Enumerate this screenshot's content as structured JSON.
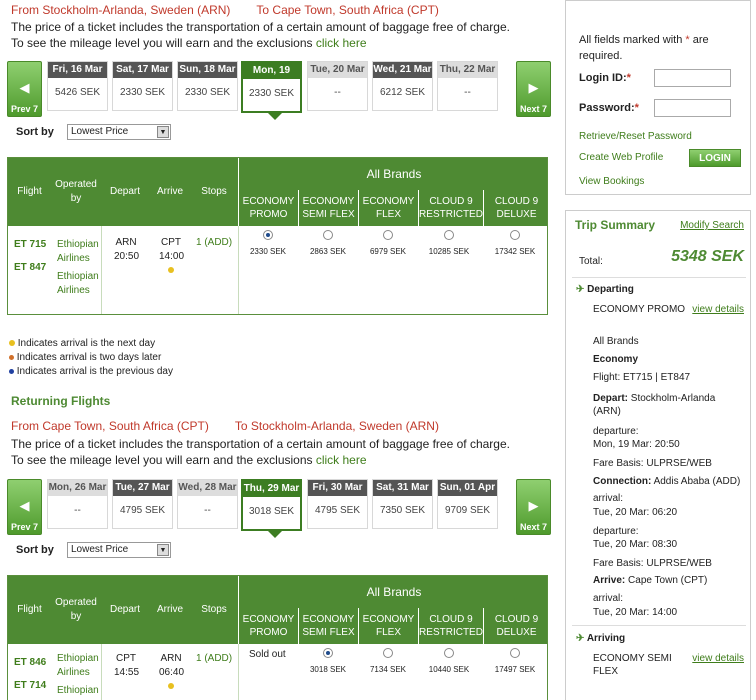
{
  "outbound": {
    "from": "From Stockholm-Arlanda, Sweden (ARN)",
    "to": "To Cape Town, South Africa (CPT)",
    "info1": "The price of a ticket includes the transportation of a certain amount of baggage free of charge.",
    "info2": "To see the mileage level you will earn and the exclusions ",
    "click_here": "click here",
    "prev_label": "Prev 7",
    "next_label": "Next 7",
    "dates": [
      {
        "day": "Fri, 16 Mar",
        "price": "5426 SEK"
      },
      {
        "day": "Sat, 17 Mar",
        "price": "2330 SEK"
      },
      {
        "day": "Sun, 18 Mar",
        "price": "2330 SEK"
      },
      {
        "day": "Mon, 19 Mar",
        "price": "2330 SEK"
      },
      {
        "day": "Tue, 20 Mar",
        "price": "--"
      },
      {
        "day": "Wed, 21 Mar",
        "price": "6212 SEK"
      },
      {
        "day": "Thu, 22 Mar",
        "price": "--"
      }
    ],
    "sort_label": "Sort by",
    "sort_value": "Lowest Price",
    "flights": "ET 715\nET 847",
    "flight1": "ET 715",
    "flight2": "ET 847",
    "operated": "Ethiopian Airlines",
    "depart_code": "ARN",
    "depart_time": "20:50",
    "arrive_code": "CPT",
    "arrive_time": "14:00",
    "stops": "1 (ADD)",
    "fares": [
      "2330 SEK",
      "2863 SEK",
      "6979 SEK",
      "10285 SEK",
      "17342 SEK"
    ]
  },
  "table_headers": {
    "flight": "Flight",
    "operated": "Operated by",
    "depart": "Depart",
    "arrive": "Arrive",
    "stops": "Stops",
    "all_brands": "All Brands",
    "brands": [
      "ECONOMY PROMO",
      "ECONOMY SEMI FLEX",
      "ECONOMY FLEX",
      "CLOUD 9 RESTRICTED",
      "CLOUD 9 DELUXE"
    ]
  },
  "legend": [
    {
      "text": "Indicates arrival is the next day",
      "color": "#e8c020"
    },
    {
      "text": "Indicates arrival is two days later",
      "color": "#d0702a"
    },
    {
      "text": "Indicates arrival is the previous day",
      "color": "#2040a0"
    }
  ],
  "returning": {
    "title": "Returning Flights",
    "from": "From Cape Town, South Africa (CPT)",
    "to": "To Stockholm-Arlanda, Sweden (ARN)",
    "info1": "The price of a ticket includes the transportation of a certain amount of baggage free of charge.",
    "info2": "To see the mileage level you will earn and the exclusions ",
    "click_here": "click here",
    "prev_label": "Prev 7",
    "next_label": "Next 7",
    "dates": [
      {
        "day": "Mon, 26 Mar",
        "price": "--"
      },
      {
        "day": "Tue, 27 Mar",
        "price": "4795 SEK"
      },
      {
        "day": "Wed, 28 Mar",
        "price": "--"
      },
      {
        "day": "Thu, 29 Mar",
        "price": "3018 SEK"
      },
      {
        "day": "Fri, 30 Mar",
        "price": "4795 SEK"
      },
      {
        "day": "Sat, 31 Mar",
        "price": "7350 SEK"
      },
      {
        "day": "Sun, 01 Apr",
        "price": "9709 SEK"
      }
    ],
    "sort_label": "Sort by",
    "sort_value": "Lowest Price",
    "flight1": "ET 846",
    "flight2": "ET 714",
    "operated": "Ethiopian Airlines",
    "operated2": "Ethiopian",
    "depart_code": "CPT",
    "depart_time": "14:55",
    "arrive_code": "ARN",
    "arrive_time": "06:40",
    "stops": "1 (ADD)",
    "sold_out": "Sold out",
    "fares": [
      "3018 SEK",
      "7134 SEK",
      "10440 SEK",
      "17497 SEK"
    ]
  },
  "login": {
    "required_note": "All fields marked with",
    "required_note2": "are required.",
    "login_id": "Login ID:",
    "password": "Password:",
    "retrieve": "Retrieve/Reset Password",
    "create": "Create Web Profile",
    "button": "LOGIN",
    "view_bookings": "View Bookings"
  },
  "trip": {
    "title": "Trip Summary",
    "modify": "Modify Search",
    "total_label": "Total:",
    "total": "5348 SEK",
    "departing": "Departing",
    "dep_fare": "ECONOMY PROMO",
    "view_details": "view details",
    "all_brands": "All Brands",
    "economy": "Economy",
    "flight": "Flight: ET715 | ET847",
    "depart_label": "Depart:",
    "depart_val": "Stockholm-Arlanda (ARN)",
    "departure1": "departure:",
    "dep_time1": "Mon, 19 Mar: 20:50",
    "fare_basis1": "Fare Basis: ULPRSE/WEB",
    "connection_label": "Connection:",
    "connection_val": "Addis Ababa (ADD)",
    "arrival1": "arrival:",
    "arr_time1": "Tue, 20 Mar: 06:20",
    "departure2": "departure:",
    "dep_time2": "Tue, 20 Mar: 08:30",
    "fare_basis2": "Fare Basis: ULPRSE/WEB",
    "arrive_label": "Arrive:",
    "arrive_val": "Cape Town (CPT)",
    "arrival2": "arrival:",
    "arr_time2": "Tue, 20 Mar: 14:00",
    "arriving": "Arriving",
    "arr_fare": "ECONOMY SEMI FLEX",
    "view_details2": "view details"
  },
  "colors": {
    "accent": "#4e8a33",
    "route": "#c0392b",
    "link": "#3f7d1b"
  }
}
